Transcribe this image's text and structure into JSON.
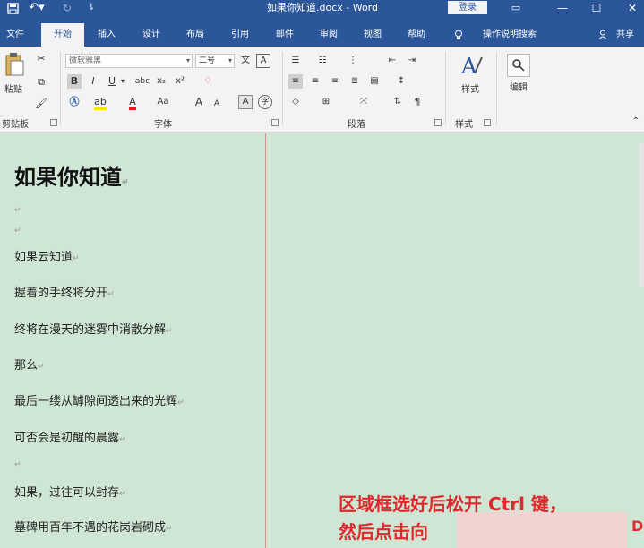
{
  "window": {
    "title": "如果你知道.docx - Word",
    "login": "登录"
  },
  "ribbon_tabs": [
    {
      "label": "文件"
    },
    {
      "label": "开始"
    },
    {
      "label": "插入"
    },
    {
      "label": "设计"
    },
    {
      "label": "布局"
    },
    {
      "label": "引用"
    },
    {
      "label": "邮件"
    },
    {
      "label": "审阅"
    },
    {
      "label": "视图"
    },
    {
      "label": "帮助"
    }
  ],
  "tell_me": "操作说明搜索",
  "share": "共享",
  "groups": {
    "clipboard": "剪贴板",
    "font": "字体",
    "paragraph": "段落",
    "styles": "样式",
    "paste": "粘贴",
    "styles_btn": "样式",
    "editing_btn": "编辑"
  },
  "font": {
    "name": "微软雅黑",
    "size": "二号",
    "wen": "文",
    "A": "A",
    "bold": "B",
    "italic": "I",
    "underline": "U",
    "strike": "abc",
    "sub": "x₂",
    "sup": "x²",
    "aa": "Aa",
    "grow": "A",
    "shrink": "A"
  },
  "document": {
    "heading": "如果你知道",
    "lines": [
      "如果云知道",
      "握着的手终将分开",
      "终将在漫天的迷雾中消散分解",
      "那么",
      "最后一缕从罅隙间透出来的光辉",
      "可否会是初醒的晨露",
      "如果，过往可以封存",
      "墓碑用百年不遇的花岗岩砌成"
    ],
    "mark": "↵"
  },
  "overlay": {
    "caption_line1": "区域框选好后松开 Ctrl 键，",
    "caption_line2": "然后点击向",
    "caption_tail": "D"
  },
  "colors": {
    "word_blue": "#2b579a",
    "page_green": "#cfe6d5",
    "caption_red": "#e0292d"
  }
}
